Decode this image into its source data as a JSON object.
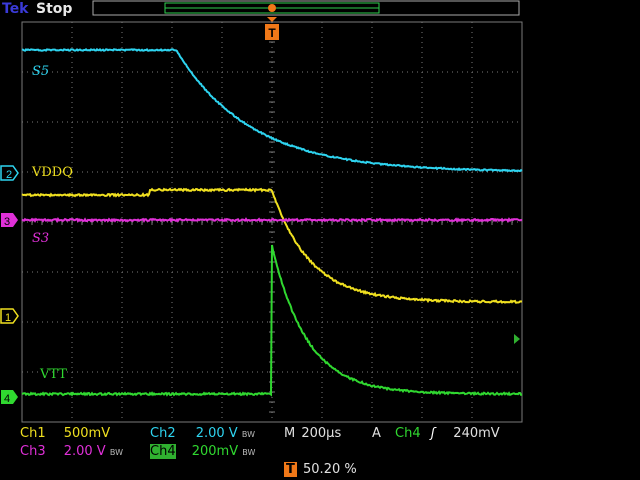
{
  "header": {
    "brand": "Tek",
    "status": "Stop"
  },
  "trigger_marker": "T",
  "traces": [
    {
      "id": "ch2",
      "marker": "2",
      "label": "S5",
      "color": "#2ed4f0"
    },
    {
      "id": "ch1",
      "marker": "",
      "label": "VDDQ",
      "color": "#f0e020"
    },
    {
      "id": "ch3",
      "marker": "3",
      "label": "S3",
      "color": "#e030d8"
    },
    {
      "id": "ch4",
      "marker": "4",
      "label": "VTT",
      "color": "#30d830"
    }
  ],
  "readout": {
    "ch1": {
      "name": "Ch1",
      "scale": "500mV"
    },
    "ch2": {
      "name": "Ch2",
      "scale": "2.00 V",
      "bw": "BW"
    },
    "ch3": {
      "name": "Ch3",
      "scale": "2.00 V",
      "bw": "BW"
    },
    "ch4": {
      "name": "Ch4",
      "scale": "200mV",
      "bw": "BW"
    },
    "timebase": {
      "label": "M",
      "value": "200µs"
    },
    "trigger": {
      "mode": "A",
      "source": "Ch4",
      "slope": "rising",
      "slope_symbol": "ʃ",
      "level": "240mV"
    },
    "position": {
      "marker": "T",
      "value": "50.20 %"
    }
  },
  "colors": {
    "ch1": "#f0e020",
    "ch2": "#2ed4f0",
    "ch3": "#e030d8",
    "ch4": "#30d830",
    "trigger": "#f07818",
    "grid": "#7a7a7a"
  }
}
